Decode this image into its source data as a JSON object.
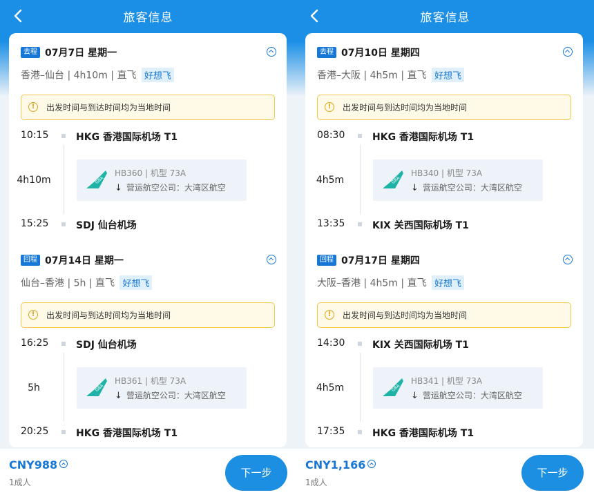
{
  "screens": [
    {
      "header": {
        "title": "旅客信息"
      },
      "segments": [
        {
          "tag": "去程",
          "date": "07月7日  星期一",
          "route": "香港–仙台 | 4h10m | 直飞",
          "badge": "好想飞",
          "notice": "出发时间与到达时间均为当地时间",
          "dep_time": "10:15",
          "dep_airport": "HKG 香港国际机场 T1",
          "duration": "4h10m",
          "flight_info": "HB360 | 机型 73A",
          "operator": "营运航空公司：大湾区航空",
          "arr_time": "15:25",
          "arr_airport": "SDJ 仙台机场"
        },
        {
          "tag": "回程",
          "date": "07月14日  星期一",
          "route": "仙台–香港 | 5h | 直飞",
          "badge": "好想飞",
          "notice": "出发时间与到达时间均为当地时间",
          "dep_time": "16:25",
          "dep_airport": "SDJ 仙台机场",
          "duration": "5h",
          "flight_info": "HB361 | 机型 73A",
          "operator": "营运航空公司：大湾区航空",
          "arr_time": "20:25",
          "arr_airport": "HKG 香港国际机场 T1"
        }
      ],
      "footer": {
        "price": "CNY988",
        "pax": "1成人",
        "next_label": "下一步"
      }
    },
    {
      "header": {
        "title": "旅客信息"
      },
      "segments": [
        {
          "tag": "去程",
          "date": "07月10日  星期四",
          "route": "香港–大阪 | 4h5m | 直飞",
          "badge": "好想飞",
          "notice": "出发时间与到达时间均为当地时间",
          "dep_time": "08:30",
          "dep_airport": "HKG 香港国际机场 T1",
          "duration": "4h5m",
          "flight_info": "HB340 | 机型 73A",
          "operator": "营运航空公司：大湾区航空",
          "arr_time": "13:35",
          "arr_airport": "KIX 关西国际机场 T1"
        },
        {
          "tag": "回程",
          "date": "07月17日  星期四",
          "route": "大阪–香港 | 4h5m | 直飞",
          "badge": "好想飞",
          "notice": "出发时间与到达时间均为当地时间",
          "dep_time": "14:30",
          "dep_airport": "KIX 关西国际机场 T1",
          "duration": "4h5m",
          "flight_info": "HB341 | 机型 73A",
          "operator": "营运航空公司：大湾区航空",
          "arr_time": "17:35",
          "arr_airport": "HKG 香港国际机场 T1"
        }
      ],
      "footer": {
        "price": "CNY1,166",
        "pax": "1成人",
        "next_label": "下一步"
      }
    }
  ],
  "colors": {
    "brand": "#1b8fe6",
    "accent": "#1677d6",
    "notice_border": "#f2c94c",
    "airline_logo": "#1fb3a8"
  },
  "icons": {
    "back": "back-arrow-icon",
    "collapse": "chevron-up-circle-icon",
    "warning": "warning-circle-icon",
    "airline": "gba-airline-logo"
  }
}
